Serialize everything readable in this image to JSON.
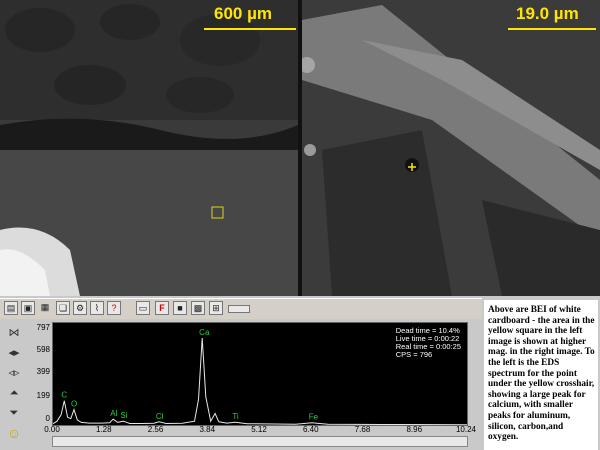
{
  "images": {
    "left_scale": "600 µm",
    "right_scale": "19.0 µm"
  },
  "toolbar": {
    "icons": [
      "open-icon",
      "save-icon",
      "print-icon",
      "copy-icon",
      "gear-icon",
      "spectrum-icon",
      "help-icon",
      "label-icon",
      "filter-icon",
      "grid-icon",
      "map-icon",
      "ruler-icon"
    ]
  },
  "spectrum": {
    "stats": {
      "dead_time": "Dead time = 10.4%",
      "live_time": "Live time = 0:00:22",
      "real_time": "Real time = 0:00:25",
      "cps": "CPS = 796"
    },
    "peaks": [
      {
        "label": "C",
        "x": 0.28
      },
      {
        "label": "O",
        "x": 0.52
      },
      {
        "label": "Al",
        "x": 1.49
      },
      {
        "label": "Si",
        "x": 1.74
      },
      {
        "label": "Cl",
        "x": 2.62
      },
      {
        "label": "Ca",
        "x": 3.69
      },
      {
        "label": "Ti",
        "x": 4.51
      },
      {
        "label": "Fe",
        "x": 6.4
      }
    ]
  },
  "chart_data": {
    "type": "line",
    "xlabel": "",
    "ylabel": "",
    "xlim": [
      0,
      10.24
    ],
    "ylim": [
      0,
      797
    ],
    "x_ticks": [
      "0.00",
      "1.28",
      "2.56",
      "3.84",
      "5.12",
      "6.40",
      "7.68",
      "8.96",
      "10.24"
    ],
    "y_ticks": [
      "797",
      "598",
      "399",
      "199",
      "0"
    ],
    "series": [
      {
        "x": [
          0.0,
          0.1,
          0.2,
          0.28,
          0.36,
          0.44,
          0.52,
          0.6,
          0.7,
          0.9,
          1.2,
          1.4,
          1.49,
          1.6,
          1.74,
          1.9,
          2.2,
          2.5,
          2.62,
          2.8,
          3.2,
          3.5,
          3.6,
          3.69,
          3.78,
          3.9,
          4.01,
          4.1,
          4.3,
          4.51,
          4.8,
          5.5,
          6.0,
          6.4,
          6.8,
          7.5,
          8.5,
          9.5,
          10.24
        ],
        "y": [
          10,
          30,
          80,
          190,
          60,
          50,
          120,
          40,
          20,
          15,
          15,
          18,
          45,
          20,
          30,
          12,
          12,
          14,
          25,
          12,
          14,
          30,
          200,
          680,
          220,
          30,
          90,
          25,
          15,
          22,
          10,
          8,
          6,
          18,
          6,
          5,
          4,
          3,
          2
        ]
      }
    ]
  },
  "caption": "Above are BEI of white cardboard - the area in the yellow square in the left image is shown at higher mag. in the right image. To the left is the EDS spectrum for the point under the yellow crosshair, showing a large peak for calcium, with smaller peaks for aluminum, silicon, carbon,and oxygen."
}
